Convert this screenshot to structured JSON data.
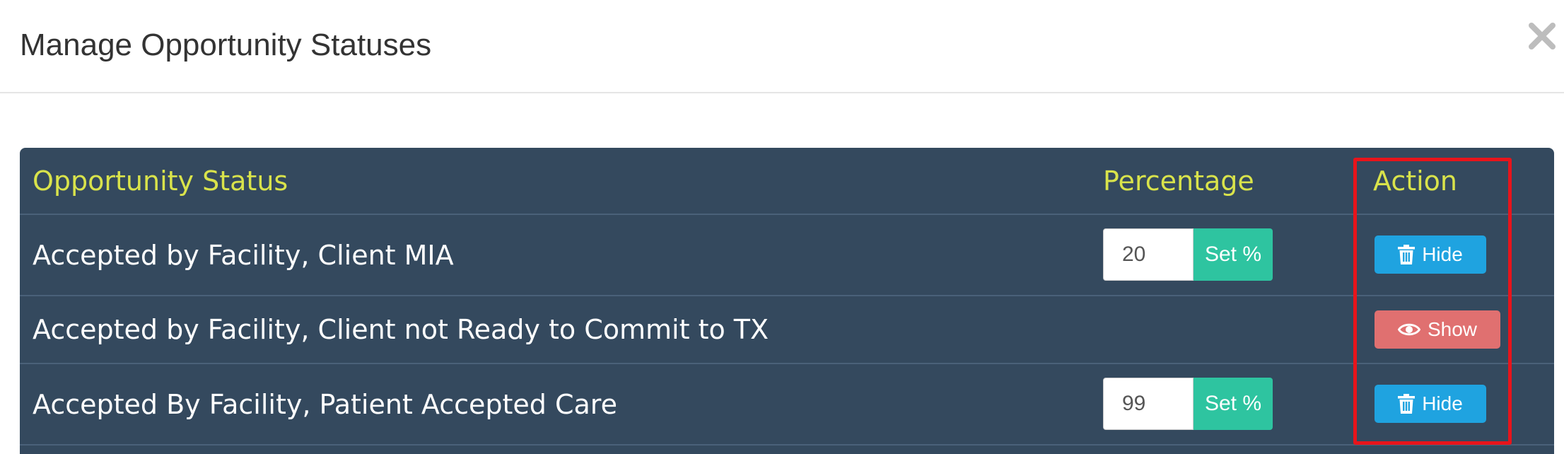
{
  "modal": {
    "title": "Manage Opportunity Statuses",
    "close_icon": "close-icon"
  },
  "table": {
    "headers": {
      "status": "Opportunity Status",
      "percentage": "Percentage",
      "action": "Action"
    },
    "rows": [
      {
        "status": "Accepted by Facility, Client MIA",
        "percentage": "20",
        "has_percentage": true,
        "set_label": "Set %",
        "action": {
          "label": "Hide",
          "icon": "trash-icon",
          "variant": "hide"
        }
      },
      {
        "status": "Accepted by Facility, Client not Ready to Commit to TX",
        "percentage": "",
        "has_percentage": false,
        "set_label": "",
        "action": {
          "label": "Show",
          "icon": "eye-icon",
          "variant": "show"
        }
      },
      {
        "status": "Accepted By Facility, Patient Accepted Care",
        "percentage": "99",
        "has_percentage": true,
        "set_label": "Set %",
        "action": {
          "label": "Hide",
          "icon": "trash-icon",
          "variant": "hide"
        }
      }
    ]
  },
  "colors": {
    "table_bg": "#34495e",
    "header_text": "#d9e34b",
    "set_button": "#2ec4a0",
    "hide_button": "#1fa3e0",
    "show_button": "#e07070",
    "highlight": "#e8141b"
  }
}
